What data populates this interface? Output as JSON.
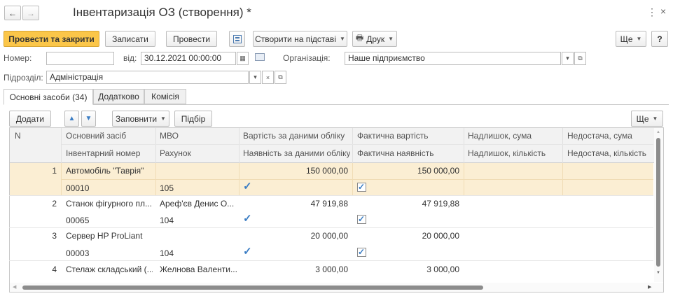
{
  "window": {
    "title": "Інвентаризація ОЗ (створення) *",
    "more_icon": "⋮",
    "close_icon": "×"
  },
  "toolbar": {
    "post_close": "Провести та закрити",
    "save": "Записати",
    "post": "Провести",
    "create_based": "Створити на підставі",
    "print": "Друк",
    "more": "Ще",
    "help": "?"
  },
  "header": {
    "number_label": "Номер:",
    "number_value": "",
    "date_label": "від:",
    "date_value": "30.12.2021 00:00:00",
    "org_label": "Організація:",
    "org_value": "Наше підприємство",
    "dept_label": "Підрозділ:",
    "dept_value": "Адміністрація"
  },
  "tabs": [
    {
      "label": "Основні засоби (34)",
      "active": true
    },
    {
      "label": "Додатково"
    },
    {
      "label": "Комісія"
    }
  ],
  "table_toolbar": {
    "add": "Додати",
    "fill": "Заповнити",
    "select": "Підбір",
    "more": "Ще"
  },
  "columns": {
    "n": "N",
    "asset": "Основний засіб",
    "inv_no": "Інвентарний номер",
    "mvo": "МВО",
    "account": "Рахунок",
    "book_value": "Вартість за даними обліку",
    "book_presence": "Наявність за даними обліку",
    "actual_value": "Фактична вартість",
    "actual_presence": "Фактична наявність",
    "surplus_sum": "Надлишок, сума",
    "surplus_qty": "Надлишок, кількість",
    "shortage_sum": "Недостача, сума",
    "shortage_qty": "Недостача, кількість"
  },
  "rows": [
    {
      "n": "1",
      "asset": "Автомобіль \"Таврія\"",
      "inv_no": "00010",
      "mvo": "",
      "account": "105",
      "book_value": "150 000,00",
      "book_presence": true,
      "actual_value": "150 000,00",
      "actual_presence": true,
      "selected": true
    },
    {
      "n": "2",
      "asset": "Станок фігурного пл...",
      "inv_no": "00065",
      "mvo": "Ареф'єв Денис О...",
      "account": "104",
      "book_value": "47 919,88",
      "book_presence": true,
      "actual_value": "47 919,88",
      "actual_presence": true
    },
    {
      "n": "3",
      "asset": "Сервер HP ProLiant",
      "inv_no": "00003",
      "mvo": "",
      "account": "104",
      "book_value": "20 000,00",
      "book_presence": true,
      "actual_value": "20 000,00",
      "actual_presence": true
    },
    {
      "n": "4",
      "asset": "Стелаж складський (...",
      "inv_no": "",
      "mvo": "Желнова Валенти...",
      "account": "",
      "book_value": "3 000,00",
      "book_presence": false,
      "actual_value": "3 000,00",
      "actual_presence": false
    }
  ],
  "colors": {
    "primary": "#fbc649",
    "selected_row": "#fbeed3",
    "check": "#3b7dc4"
  }
}
